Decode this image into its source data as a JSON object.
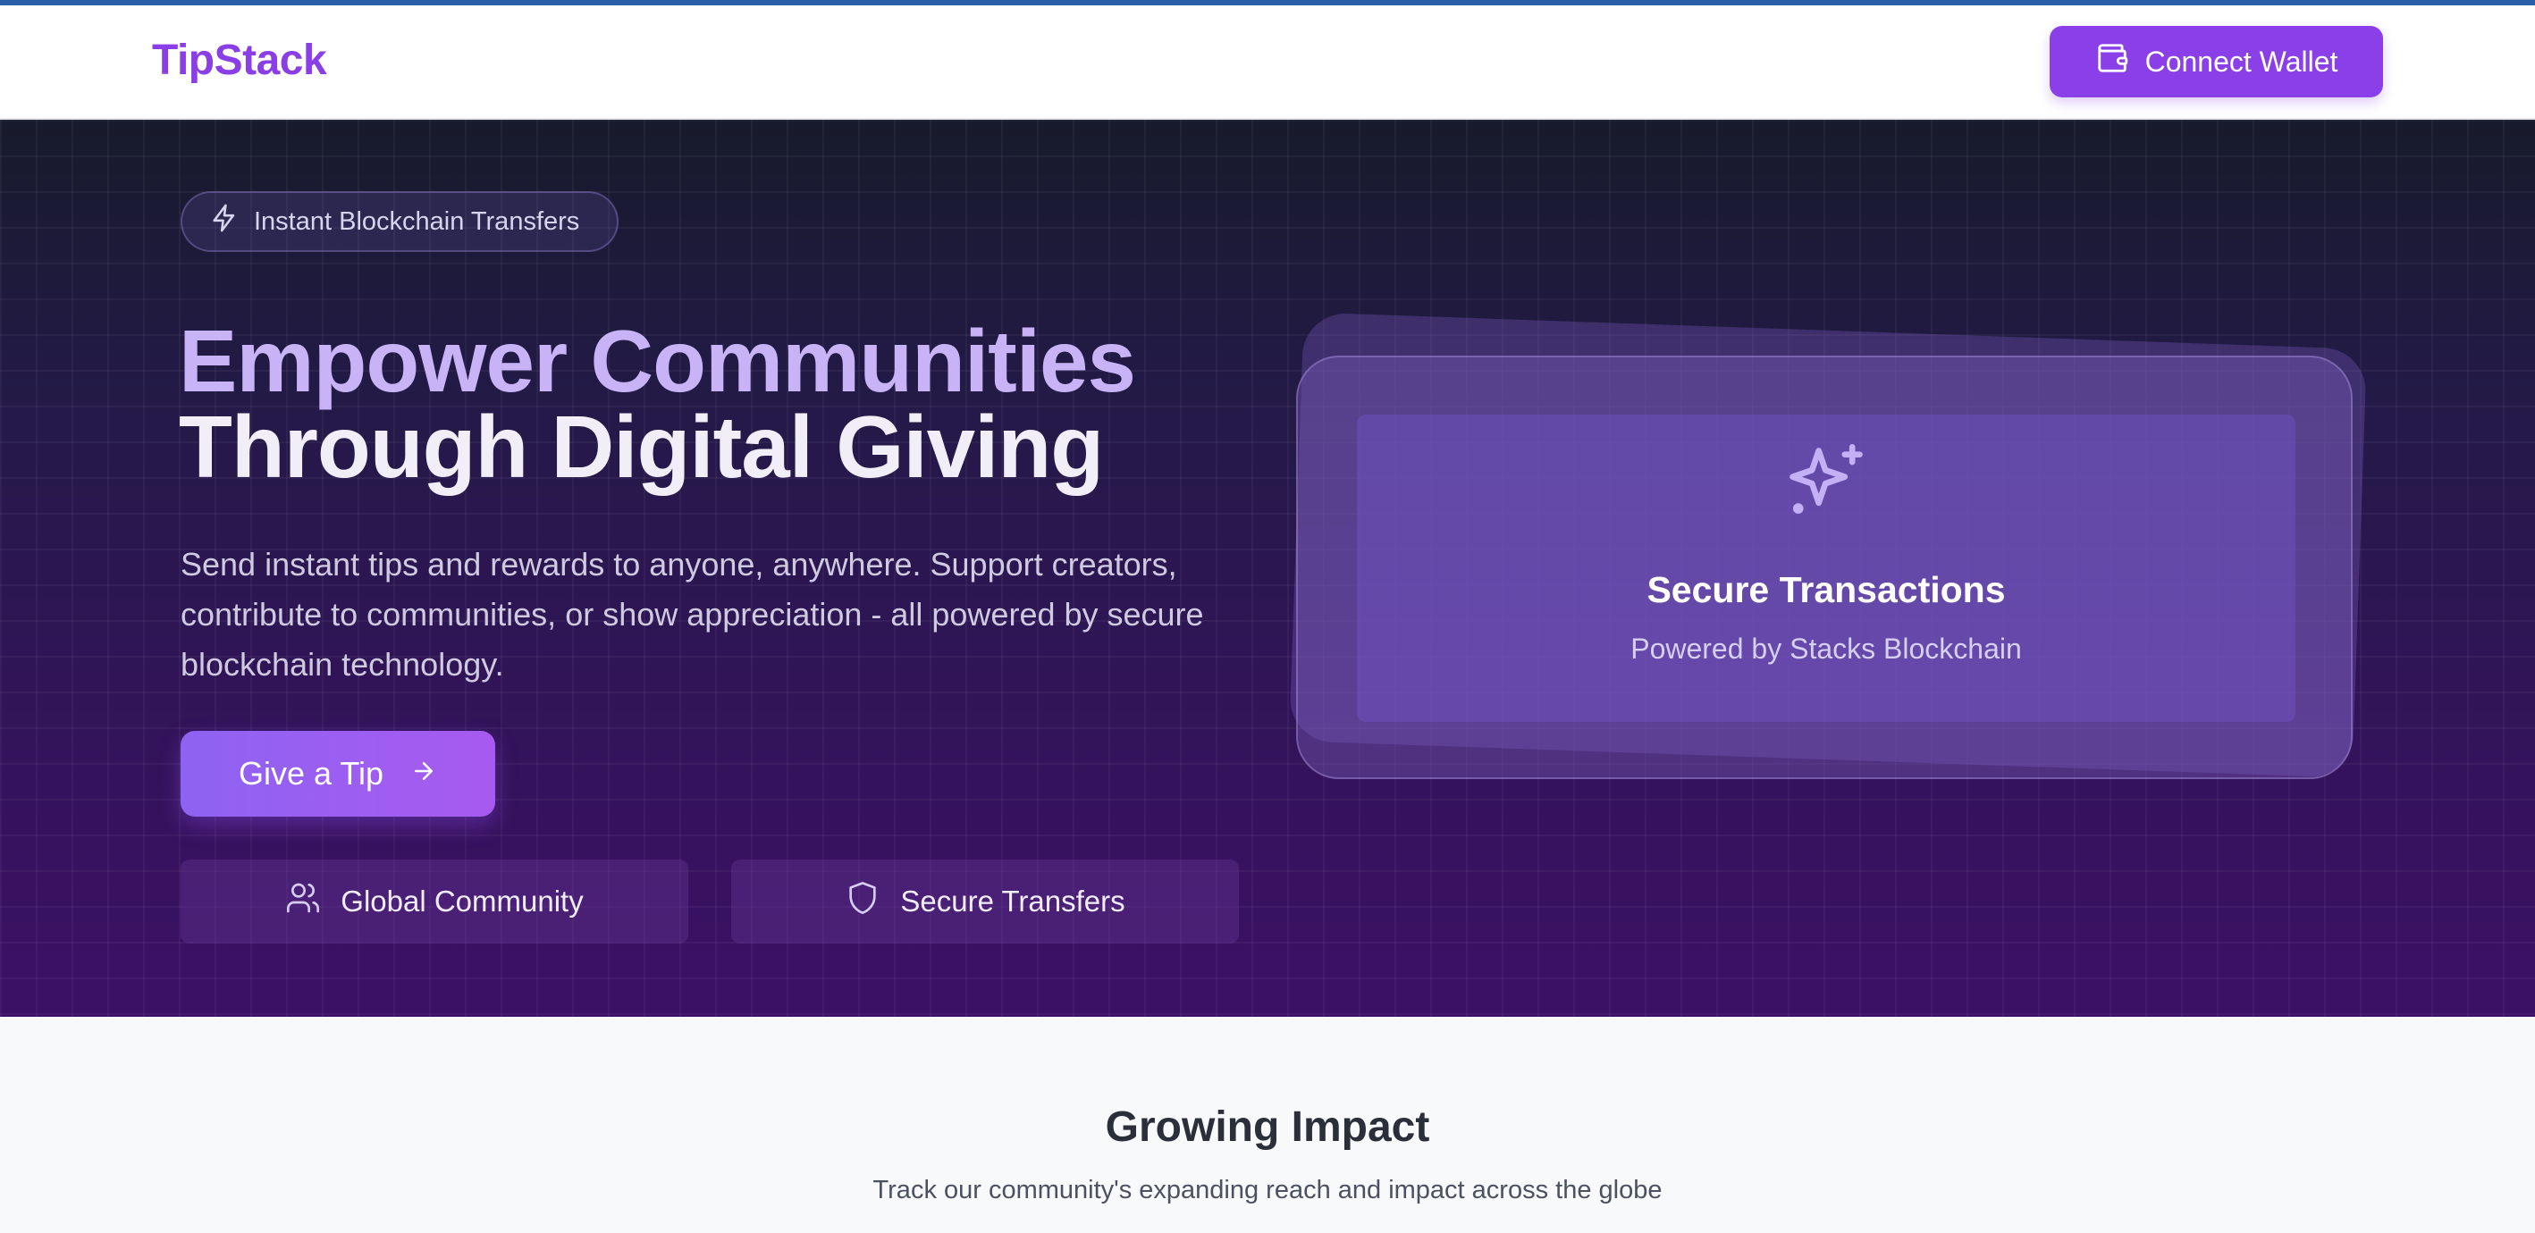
{
  "header": {
    "logo": "TipStack",
    "connect_label": "Connect Wallet"
  },
  "hero": {
    "pill_label": "Instant Blockchain Transfers",
    "headline_line1": "Empower Communities",
    "headline_line2": "Through Digital Giving",
    "subtext": "Send instant tips and rewards to anyone, anywhere. Support creators, contribute to communities, or show appreciation - all powered by secure blockchain technology.",
    "cta_label": "Give a Tip",
    "features": [
      {
        "label": "Global Community",
        "icon": "users-icon"
      },
      {
        "label": "Secure Transfers",
        "icon": "shield-icon"
      }
    ]
  },
  "card": {
    "icon": "sparkles-icon",
    "title": "Secure Transactions",
    "subtitle": "Powered by Stacks Blockchain"
  },
  "impact": {
    "title": "Growing Impact",
    "subtitle": "Track our community's expanding reach and impact across the globe"
  },
  "colors": {
    "brand": "#8a3ee6",
    "hero_top": "#171a2b",
    "hero_bottom": "#3b1166",
    "headline_accent": "#c9b3f7"
  }
}
